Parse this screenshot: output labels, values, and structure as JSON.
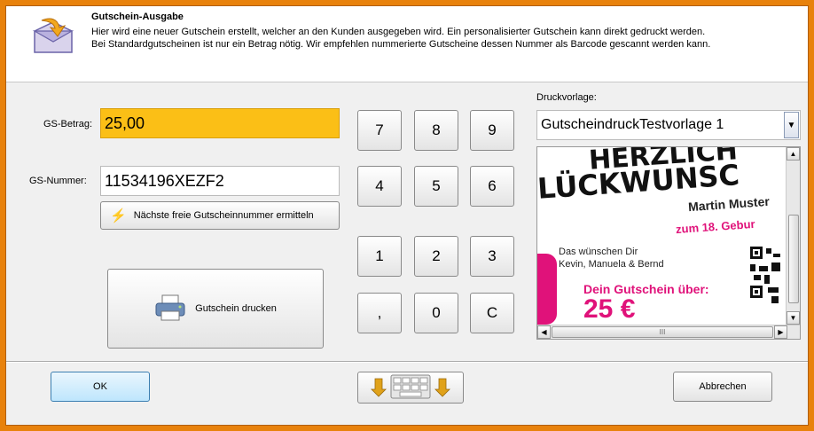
{
  "header": {
    "title": "Gutschein-Ausgabe",
    "line1": "Hier wird eine neuer Gutschein erstellt, welcher an den Kunden ausgegeben wird. Ein personalisierter Gutschein kann direkt gedruckt werden.",
    "line2": "Bei Standardgutscheinen ist nur ein Betrag nötig. Wir empfehlen nummerierte Gutscheine dessen Nummer als Barcode gescannt werden kann."
  },
  "form": {
    "betrag_label": "GS-Betrag:",
    "betrag_value": "25,00",
    "nummer_label": "GS-Nummer:",
    "nummer_value": "11534196XEZF2",
    "next_number_button": "Nächste freie Gutscheinnummer ermitteln",
    "print_button": "Gutschein drucken"
  },
  "keypad": {
    "keys": [
      "7",
      "8",
      "9",
      "4",
      "5",
      "6",
      "1",
      "2",
      "3",
      ",",
      "0",
      "C"
    ]
  },
  "template": {
    "label": "Druckvorlage:",
    "selected": "GutscheindruckTestvorlage 1",
    "preview": {
      "headline1": "HERZLICH",
      "headline2": "LÜCKWUNSC",
      "name": "Martin Muster",
      "occasion": "zum 18. Gebur",
      "wish_line1": "Das wünschen Dir",
      "wish_line2": "Kevin, Manuela & Bernd",
      "voucher_text": "Dein Gutschein über:",
      "amount": "25 €",
      "scroll_mark": "III"
    }
  },
  "footer": {
    "ok": "OK",
    "cancel": "Abbrechen"
  },
  "colors": {
    "frame": "#e8820c",
    "betrag_bg": "#fbbf16",
    "accent_pink": "#e0127a"
  }
}
